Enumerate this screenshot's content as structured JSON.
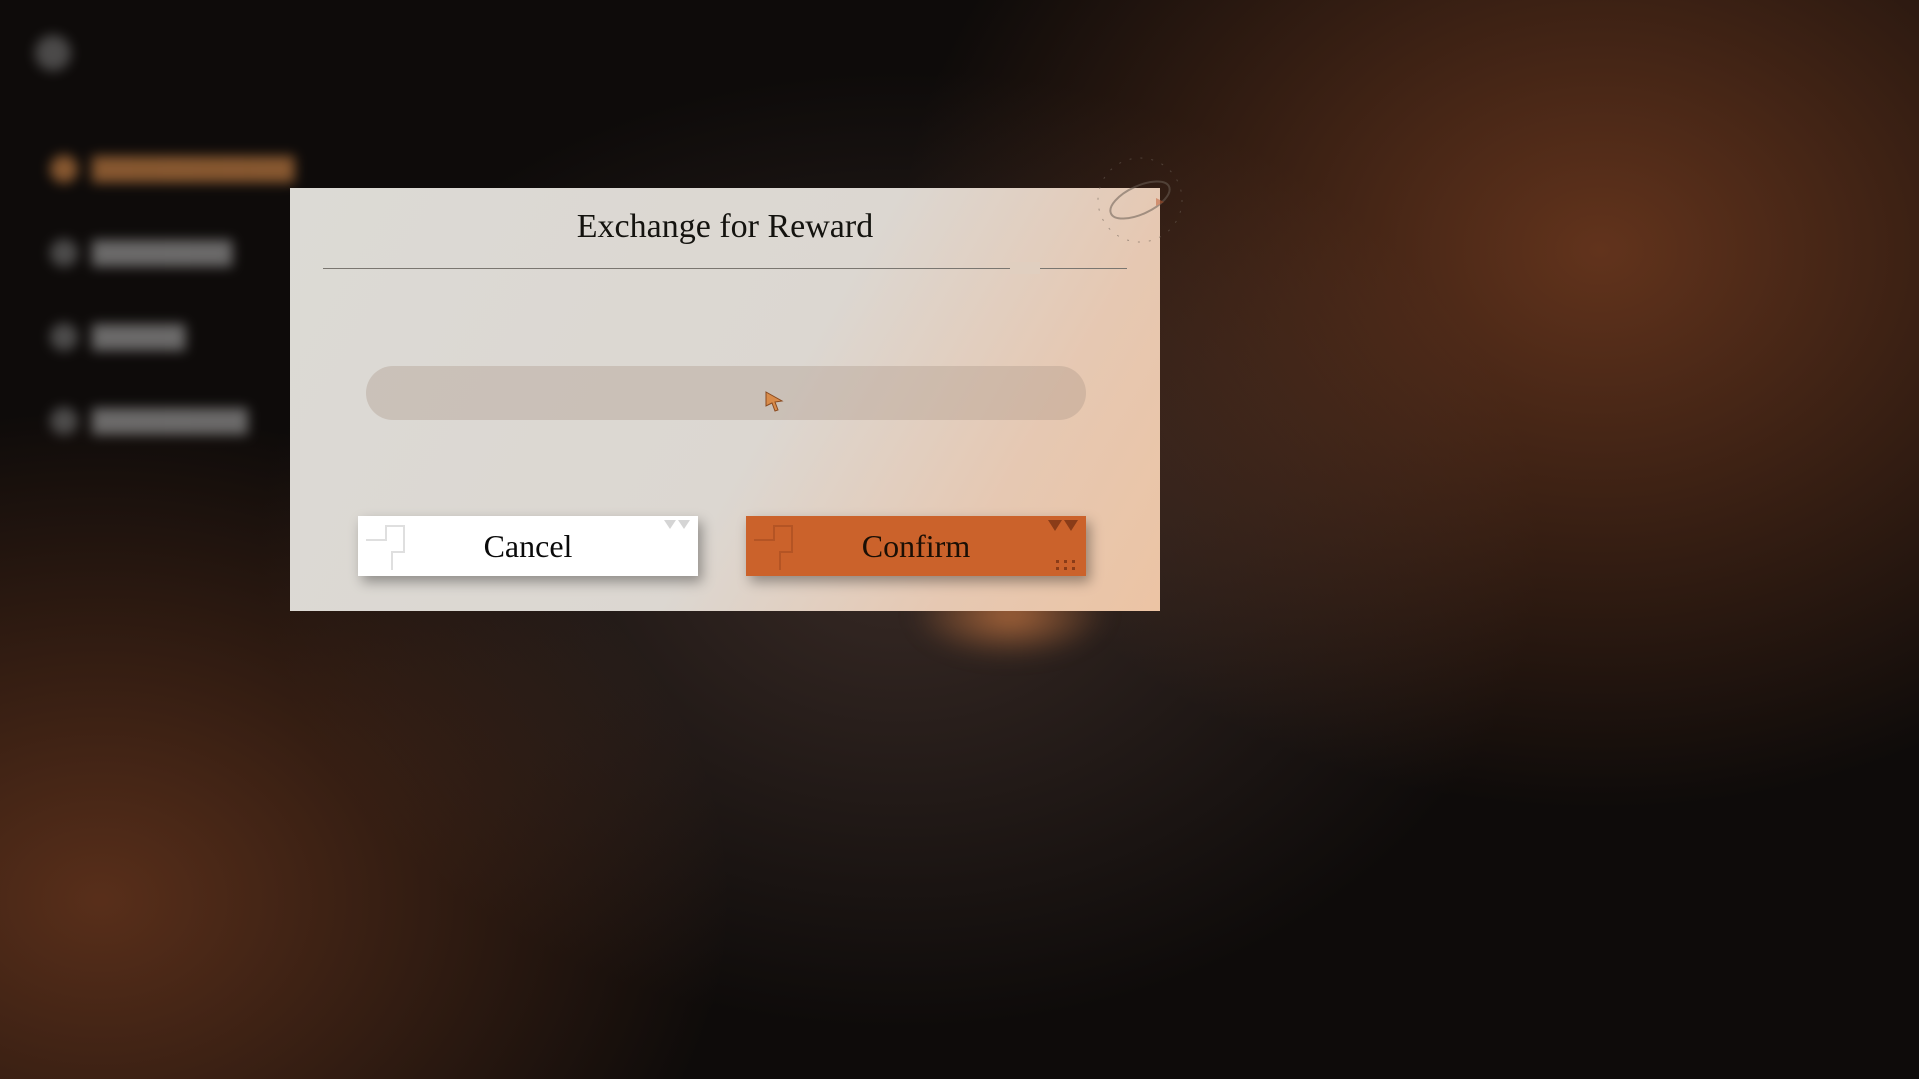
{
  "modal": {
    "title": "Exchange for Reward",
    "input_value": "",
    "cancel_label": "Cancel",
    "confirm_label": "Confirm"
  },
  "colors": {
    "accent": "#cb622b",
    "modal_bg": "#dcdad5"
  },
  "icons": {
    "cursor": "cursor-icon",
    "orbit": "orbit-decoration-icon"
  }
}
